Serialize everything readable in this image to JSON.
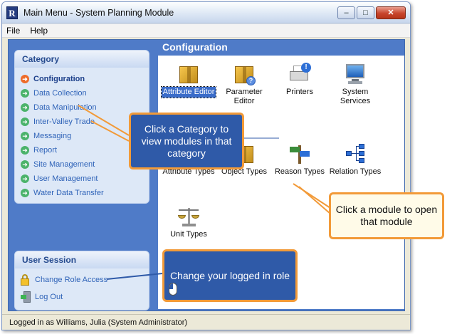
{
  "window": {
    "title": "Main Menu  -  System Planning Module",
    "app_icon_letter": "R",
    "controls": {
      "minimize": "–",
      "maximize": "□",
      "close": "✕"
    }
  },
  "menubar": {
    "items": [
      "File",
      "Help"
    ]
  },
  "category_panel": {
    "title": "Category",
    "items": [
      {
        "label": "Configuration",
        "active": true
      },
      {
        "label": "Data Collection",
        "active": false
      },
      {
        "label": "Data Manipulation",
        "active": false
      },
      {
        "label": "Inter-Valley Trade",
        "active": false
      },
      {
        "label": "Messaging",
        "active": false
      },
      {
        "label": "Report",
        "active": false
      },
      {
        "label": "Site Management",
        "active": false
      },
      {
        "label": "User Management",
        "active": false
      },
      {
        "label": "Water Data Transfer",
        "active": false
      }
    ]
  },
  "session_panel": {
    "title": "User Session",
    "items": [
      {
        "label": "Change Role Access",
        "icon": "lock-icon"
      },
      {
        "label": "Log Out",
        "icon": "logout-icon"
      }
    ]
  },
  "main": {
    "section_title": "Configuration",
    "modules": [
      {
        "label": "Attribute Editor",
        "icon": "package-icon",
        "selected": true
      },
      {
        "label": "Parameter Editor",
        "icon": "package-help-icon",
        "selected": false
      },
      {
        "label": "Printers",
        "icon": "printer-icon",
        "selected": false
      },
      {
        "label": "System Services",
        "icon": "monitor-icon",
        "selected": false
      },
      {
        "label": "Attribute Types",
        "icon": "package-icon",
        "selected": false
      },
      {
        "label": "Object Types",
        "icon": "package-icon",
        "selected": false
      },
      {
        "label": "Reason Types",
        "icon": "signpost-icon",
        "selected": false
      },
      {
        "label": "Relation Types",
        "icon": "relation-icon",
        "selected": false
      },
      {
        "label": "Unit Types",
        "icon": "scale-icon",
        "selected": false
      }
    ]
  },
  "status": {
    "text": "Logged in as Williams, Julia (System Administrator)"
  },
  "callouts": {
    "category": "Click a Category to view modules in that category",
    "module": "Click a module to open that module",
    "role": "Change your logged in role"
  },
  "colors": {
    "accent": "#4f7bc8",
    "callout_border": "#f29a38",
    "callout_fill": "#2f5aa8"
  }
}
